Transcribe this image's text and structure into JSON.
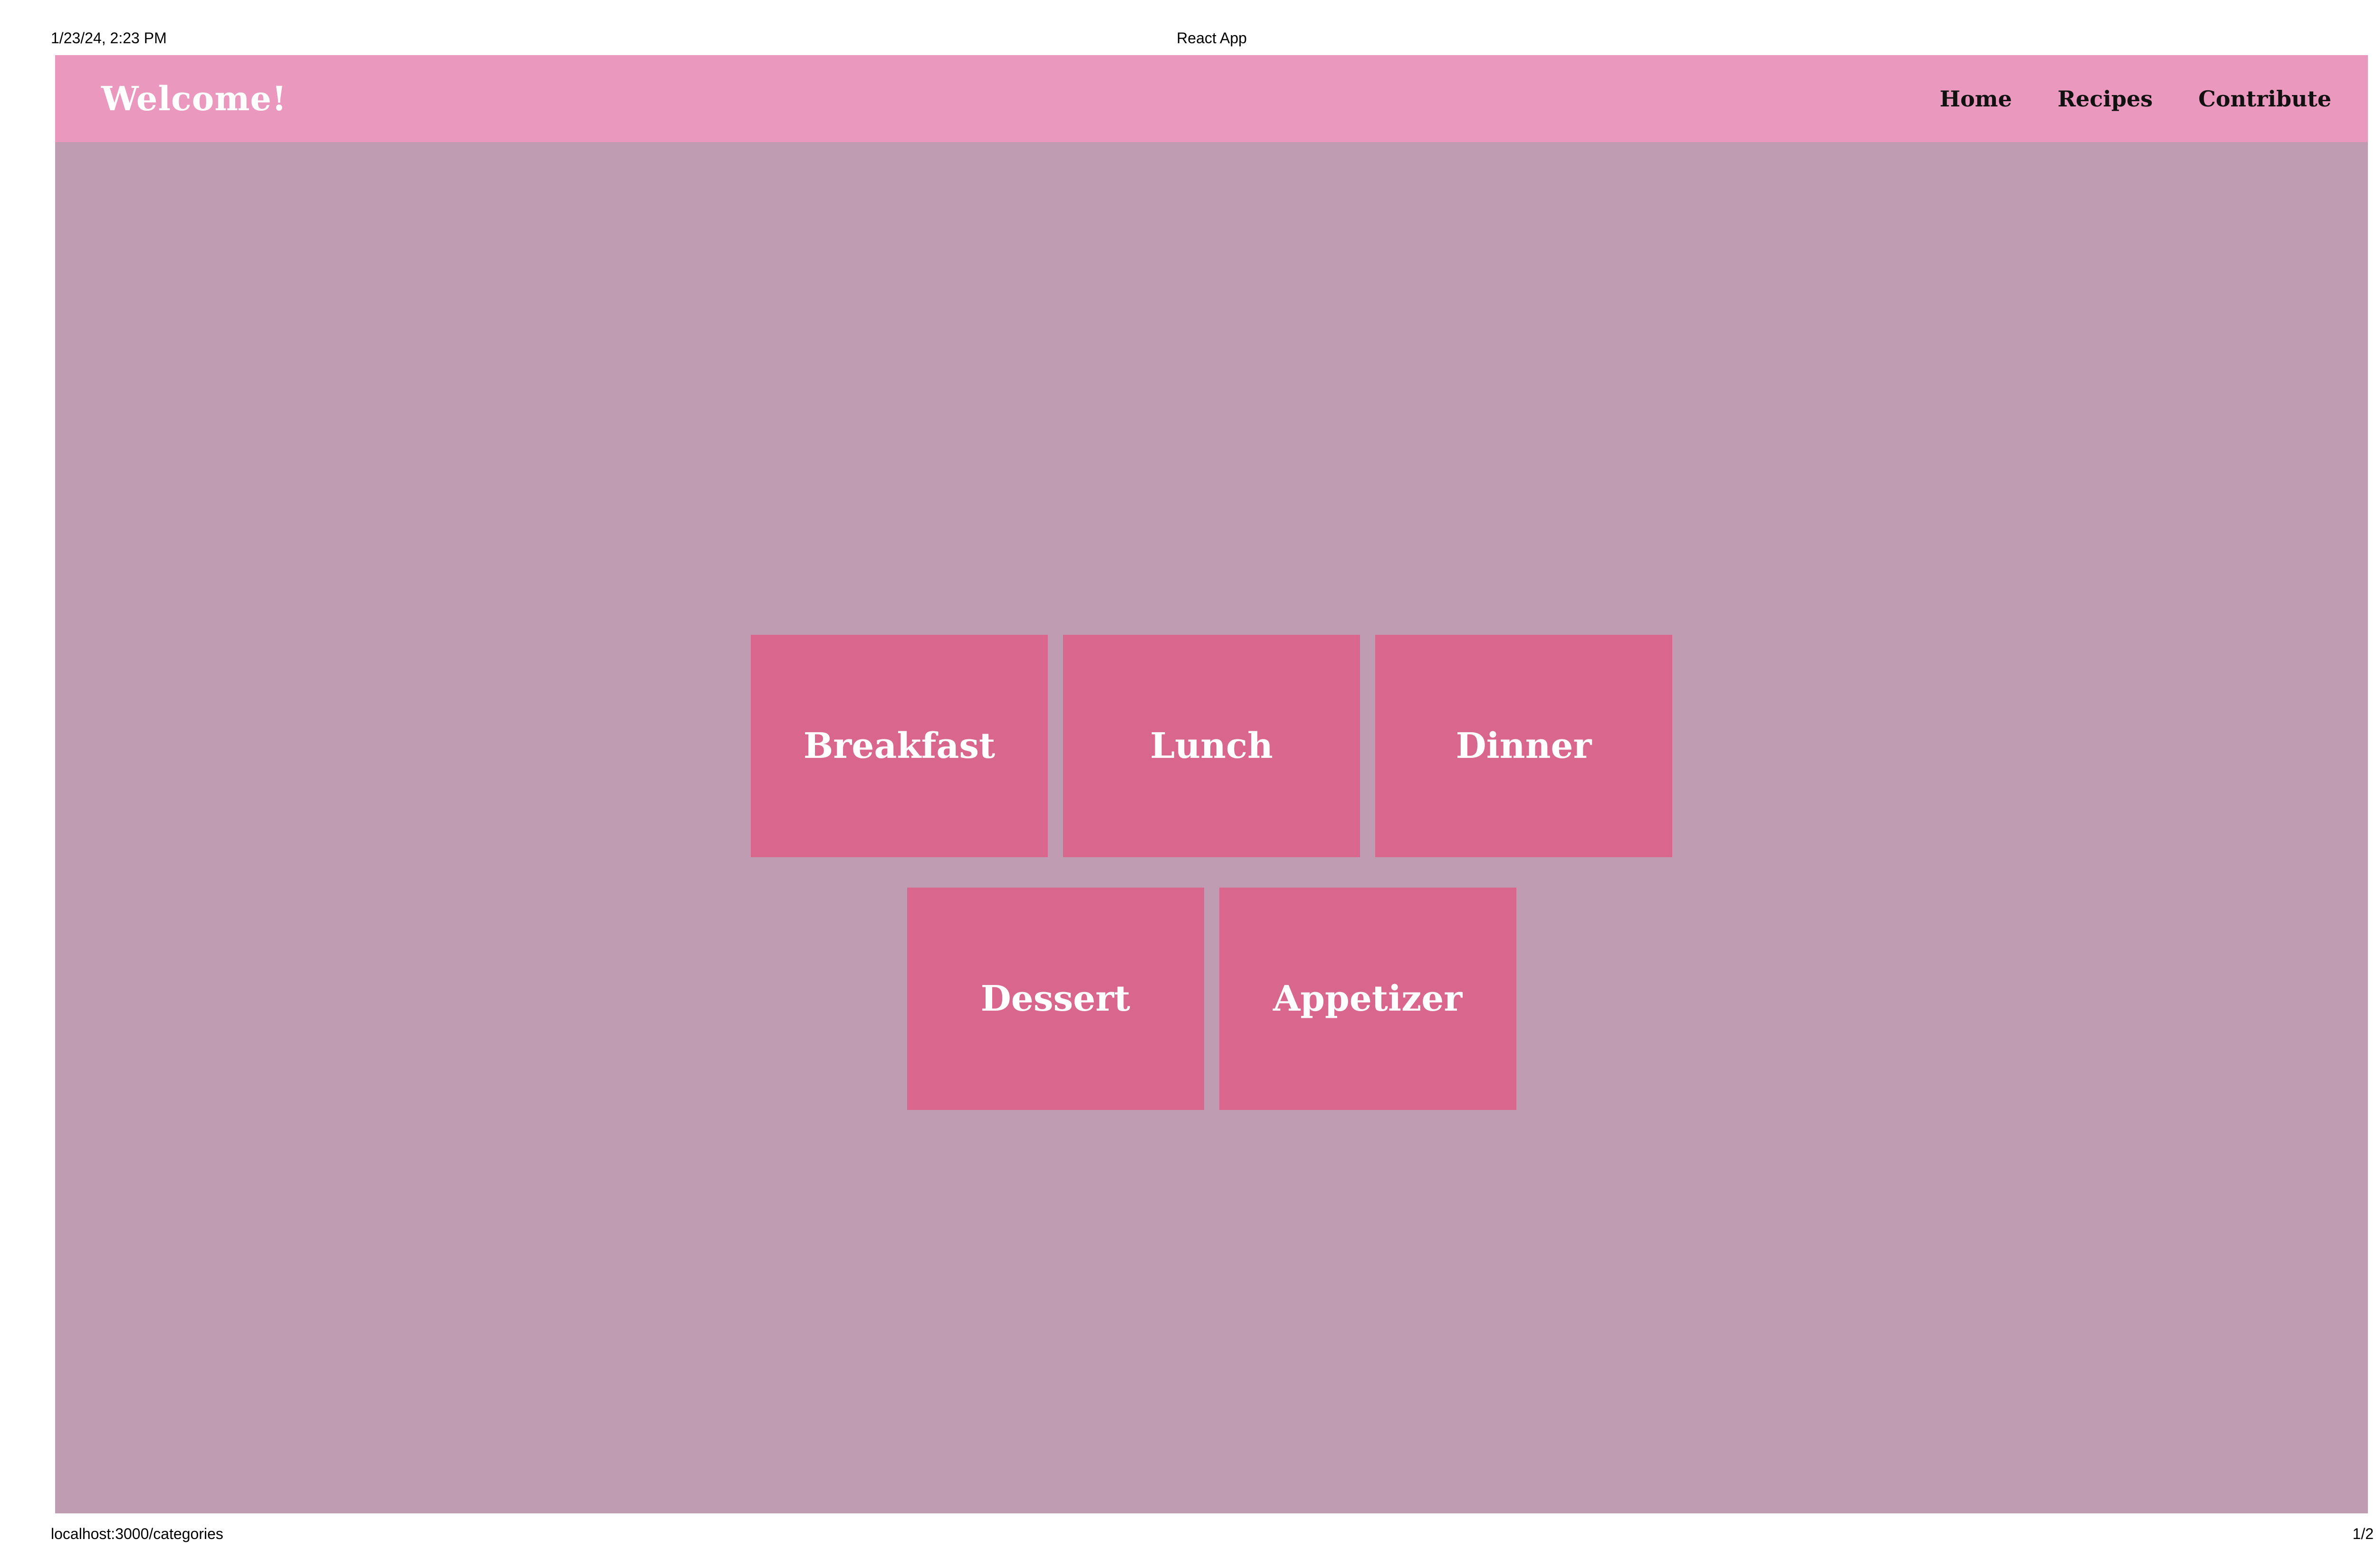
{
  "print_header": {
    "datetime": "1/23/24, 2:23 PM",
    "page_title": "React App"
  },
  "print_footer": {
    "url": "localhost:3000/categories",
    "page_number": "1/2"
  },
  "navbar": {
    "brand": "Welcome!",
    "links": [
      {
        "label": "Home"
      },
      {
        "label": "Recipes"
      },
      {
        "label": "Contribute"
      }
    ]
  },
  "categories": [
    {
      "label": "Breakfast"
    },
    {
      "label": "Lunch"
    },
    {
      "label": "Dinner"
    },
    {
      "label": "Dessert"
    },
    {
      "label": "Appetizer"
    }
  ],
  "colors": {
    "page_background": "#c09cb2",
    "navbar_background": "#ea98bd",
    "card_background": "#d9668c",
    "card_text": "#ffffff",
    "nav_text": "#111111"
  }
}
